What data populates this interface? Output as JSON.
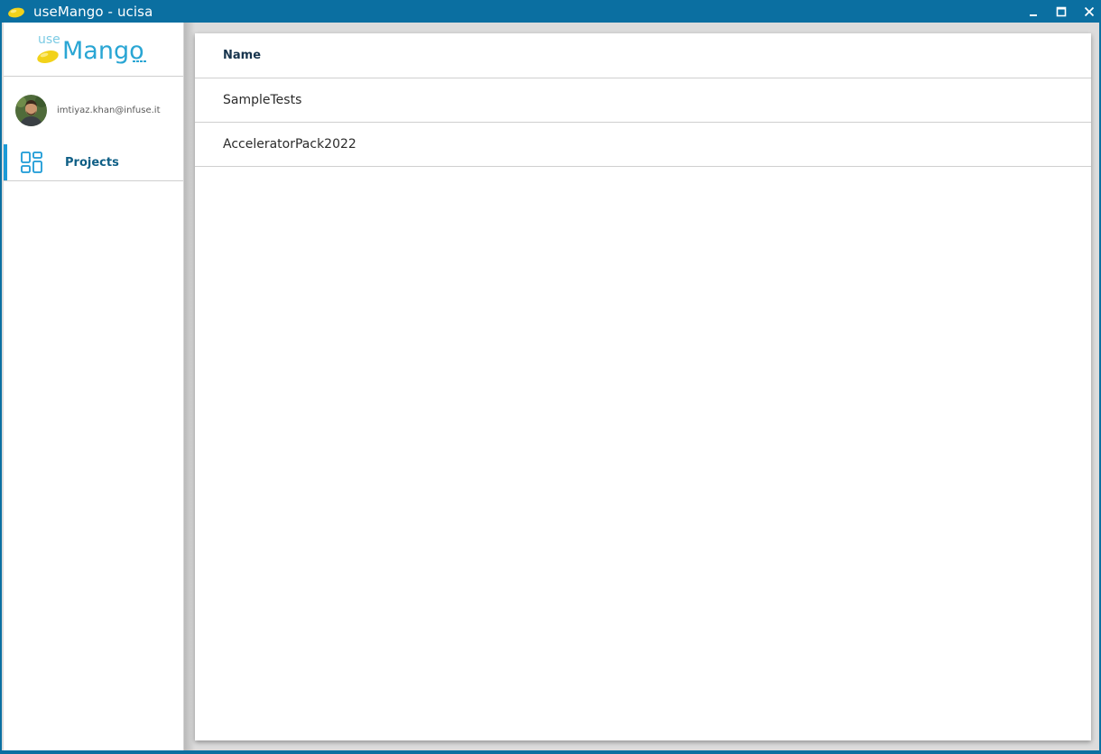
{
  "window": {
    "title": "useMango - ucisa",
    "accent_color": "#0b6fa1",
    "controls": [
      "minimize-icon",
      "maximize-icon",
      "close-icon"
    ]
  },
  "sidebar": {
    "logo": {
      "prefix": "use",
      "name": "Mango"
    },
    "user": {
      "email": "imtiyaz.khan@infuse.it"
    },
    "nav": [
      {
        "label": "Projects",
        "icon": "dashboard-grid-icon",
        "active": true
      }
    ]
  },
  "main": {
    "table": {
      "columns": [
        "Name"
      ],
      "rows": [
        {
          "name": "SampleTests"
        },
        {
          "name": "AcceleratorPack2022"
        }
      ]
    }
  }
}
